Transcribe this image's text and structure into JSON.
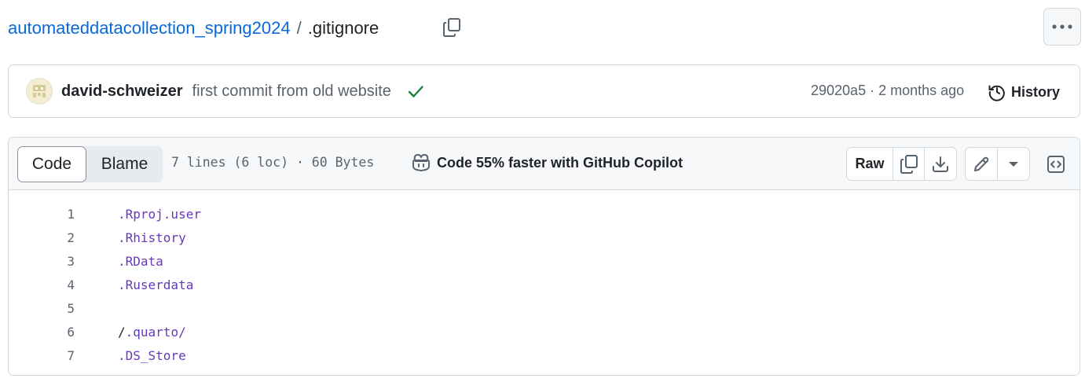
{
  "breadcrumb": {
    "repo": "automateddatacollection_spring2024",
    "separator": "/",
    "file": ".gitignore"
  },
  "commit": {
    "author": "david-schweizer",
    "message": "first commit from old website",
    "status": "success",
    "meta": "29020a5 · 2 months ago",
    "history_label": "History"
  },
  "file_header": {
    "tabs": [
      {
        "label": "Code",
        "selected": true
      },
      {
        "label": "Blame",
        "selected": false
      }
    ],
    "info": "7 lines (6 loc) · 60 Bytes",
    "copilot_text": "Code 55% faster with GitHub Copilot",
    "raw_label": "Raw"
  },
  "lines": [
    {
      "num": "1",
      "text": ".Rproj.user"
    },
    {
      "num": "2",
      "text": ".Rhistory"
    },
    {
      "num": "3",
      "text": ".RData"
    },
    {
      "num": "4",
      "text": ".Ruserdata"
    },
    {
      "num": "5",
      "text": ""
    },
    {
      "num": "6",
      "prefix": "/",
      "text": ".quarto/"
    },
    {
      "num": "7",
      "text": ".DS_Store"
    }
  ],
  "colors": {
    "link": "#0969da",
    "success": "#1a7f37",
    "syntax_purple": "#6639ba",
    "muted": "#59636e",
    "border": "#d1d9e0"
  }
}
